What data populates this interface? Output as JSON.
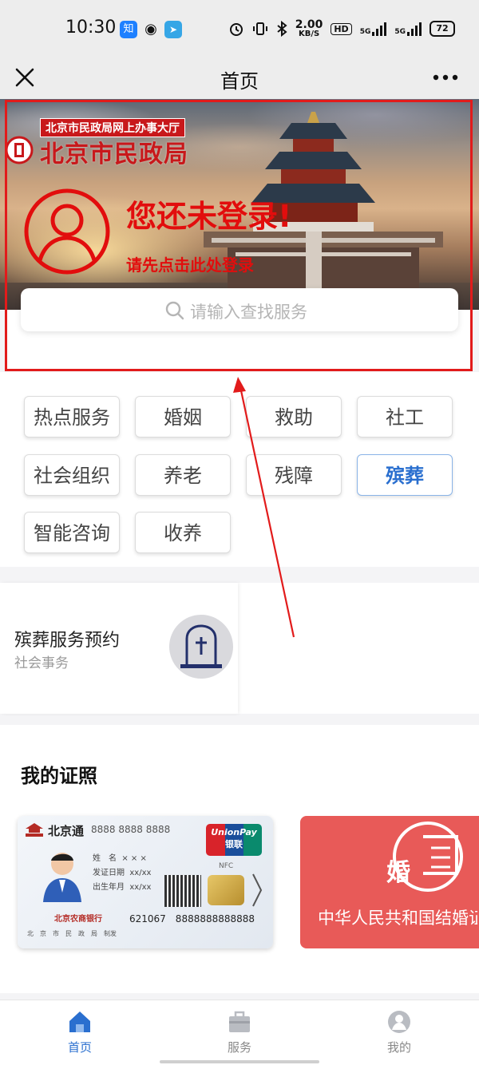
{
  "status_bar": {
    "time": "10:30",
    "apps": [
      "zhihu-icon",
      "weibo-icon",
      "telegram-icon"
    ],
    "speed_value": "2.00",
    "speed_unit": "KB/S",
    "hd": "HD",
    "net1": "5G",
    "net2": "5G",
    "battery": "72"
  },
  "nav": {
    "title": "首页"
  },
  "banner": {
    "bureau_subtitle": "北京市民政局网上办事大厅",
    "bureau_name": "北京市民政局",
    "login_title": "您还未登录!",
    "login_subtitle": "请先点击此处登录"
  },
  "search": {
    "placeholder": "请输入查找服务"
  },
  "categories": [
    {
      "label": "热点服务",
      "active": false
    },
    {
      "label": "婚姻",
      "active": false
    },
    {
      "label": "救助",
      "active": false
    },
    {
      "label": "社工",
      "active": false
    },
    {
      "label": "社会组织",
      "active": false
    },
    {
      "label": "养老",
      "active": false
    },
    {
      "label": "残障",
      "active": false
    },
    {
      "label": "殡葬",
      "active": true
    },
    {
      "label": "智能咨询",
      "active": false
    },
    {
      "label": "收养",
      "active": false
    }
  ],
  "service": {
    "title": "殡葬服务预约",
    "subtitle": "社会事务"
  },
  "license": {
    "title": "我的证照",
    "id_card": {
      "brand": "北京通",
      "number_top": "8888 8888 8888",
      "name_label": "姓　名",
      "name_value": "× × ×",
      "issue_label": "发证日期",
      "issue_value": "xx/xx",
      "birth_label": "出生年月",
      "birth_value": "xx/xx",
      "unionpay": "UnionPay",
      "unionpay_cn": "银联",
      "nfc": "NFC",
      "bank": "北京农商银行",
      "card_number": "621067　8888888888888",
      "issuer": "北　京　市　民　政　局　制发"
    },
    "marriage_card": {
      "char": "婚",
      "text": "中华人民共和国结婚证"
    }
  },
  "tabs": [
    {
      "label": "首页",
      "active": true
    },
    {
      "label": "服务",
      "active": false
    },
    {
      "label": "我的",
      "active": false
    }
  ],
  "colors": {
    "accent": "#2a6fcf",
    "annotation_red": "#e21b1b",
    "login_red": "#e20d0d",
    "bureau_red": "#c8181b"
  }
}
